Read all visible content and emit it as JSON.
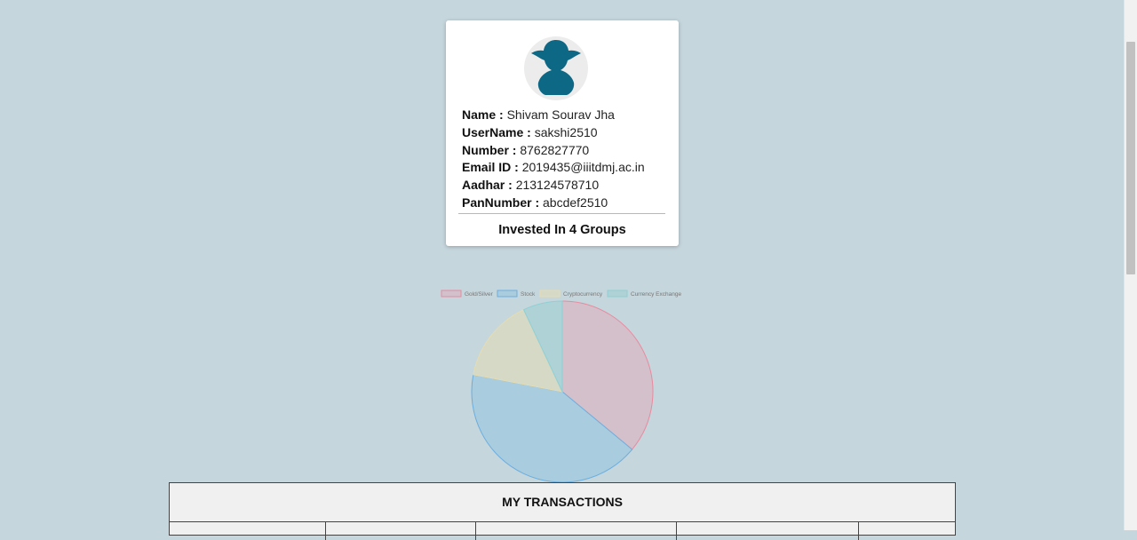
{
  "profile": {
    "avatar_icon": "user-silhouette-icon",
    "avatar_color": "#0d6885",
    "fields": [
      {
        "label": "Name :",
        "value": "Shivam Sourav Jha"
      },
      {
        "label": "UserName :",
        "value": "sakshi2510"
      },
      {
        "label": "Number :",
        "value": "8762827770"
      },
      {
        "label": "Email ID :",
        "value": "2019435@iiitdmj.ac.in"
      },
      {
        "label": "Aadhar :",
        "value": "213124578710"
      },
      {
        "label": "PanNumber :",
        "value": "abcdef2510"
      }
    ],
    "invested_text": "Invested In 4 Groups"
  },
  "chart_data": {
    "type": "pie",
    "legend_position": "top",
    "categories": [
      "Gold/Silver",
      "Stock",
      "Cryptocurrency",
      "Currency Exchange"
    ],
    "values": [
      36,
      42,
      15,
      7
    ],
    "colors": [
      "#d3c0ca",
      "#a9ccdf",
      "#d5d9c6",
      "#aed2d5"
    ],
    "border_colors": [
      "#e88a9f",
      "#6aaee0",
      "#e6dcb0",
      "#8fd0d5"
    ]
  },
  "transactions": {
    "title": "MY TRANSACTIONS"
  }
}
